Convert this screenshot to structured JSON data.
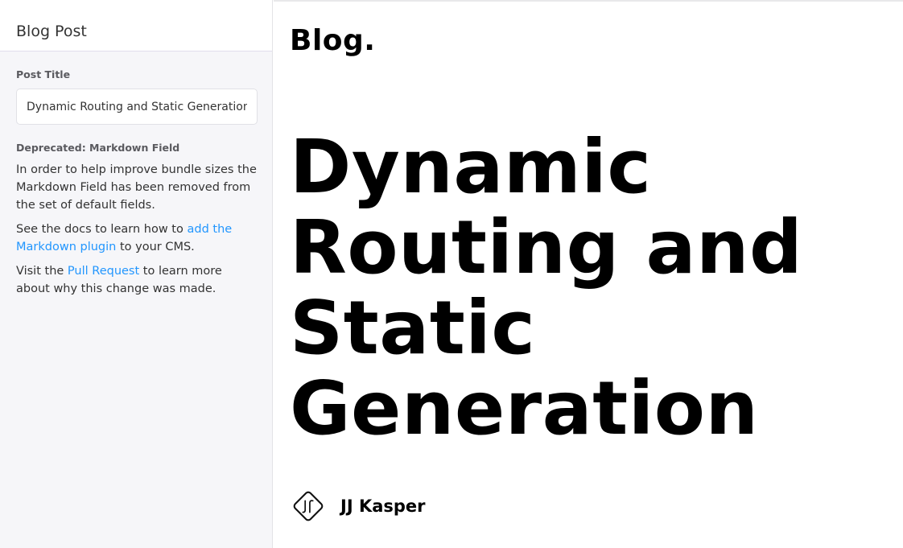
{
  "sidebar": {
    "title": "Blog Post",
    "post_title_label": "Post Title",
    "post_title_value": "Dynamic Routing and Static Generation",
    "deprecated_label": "Deprecated: Markdown Field",
    "para1": "In order to help improve bundle sizes the Markdown Field has been removed from the set of default fields.",
    "para2": {
      "before": "See the docs to learn how to ",
      "link": "add the Markdown plugin",
      "after": " to your CMS."
    },
    "para3": {
      "before": "Visit the ",
      "link": "Pull Request",
      "after": " to learn more about why this change was made."
    }
  },
  "preview": {
    "brand": "Blog.",
    "heading": "Dynamic Routing and Static Generation",
    "author": {
      "name": "JJ Kasper",
      "avatar_icon": "jj-monogram-avatar"
    }
  },
  "colors": {
    "link": "#2296fe",
    "sidebar_bg": "#f6f6f9",
    "text": "#333333"
  }
}
